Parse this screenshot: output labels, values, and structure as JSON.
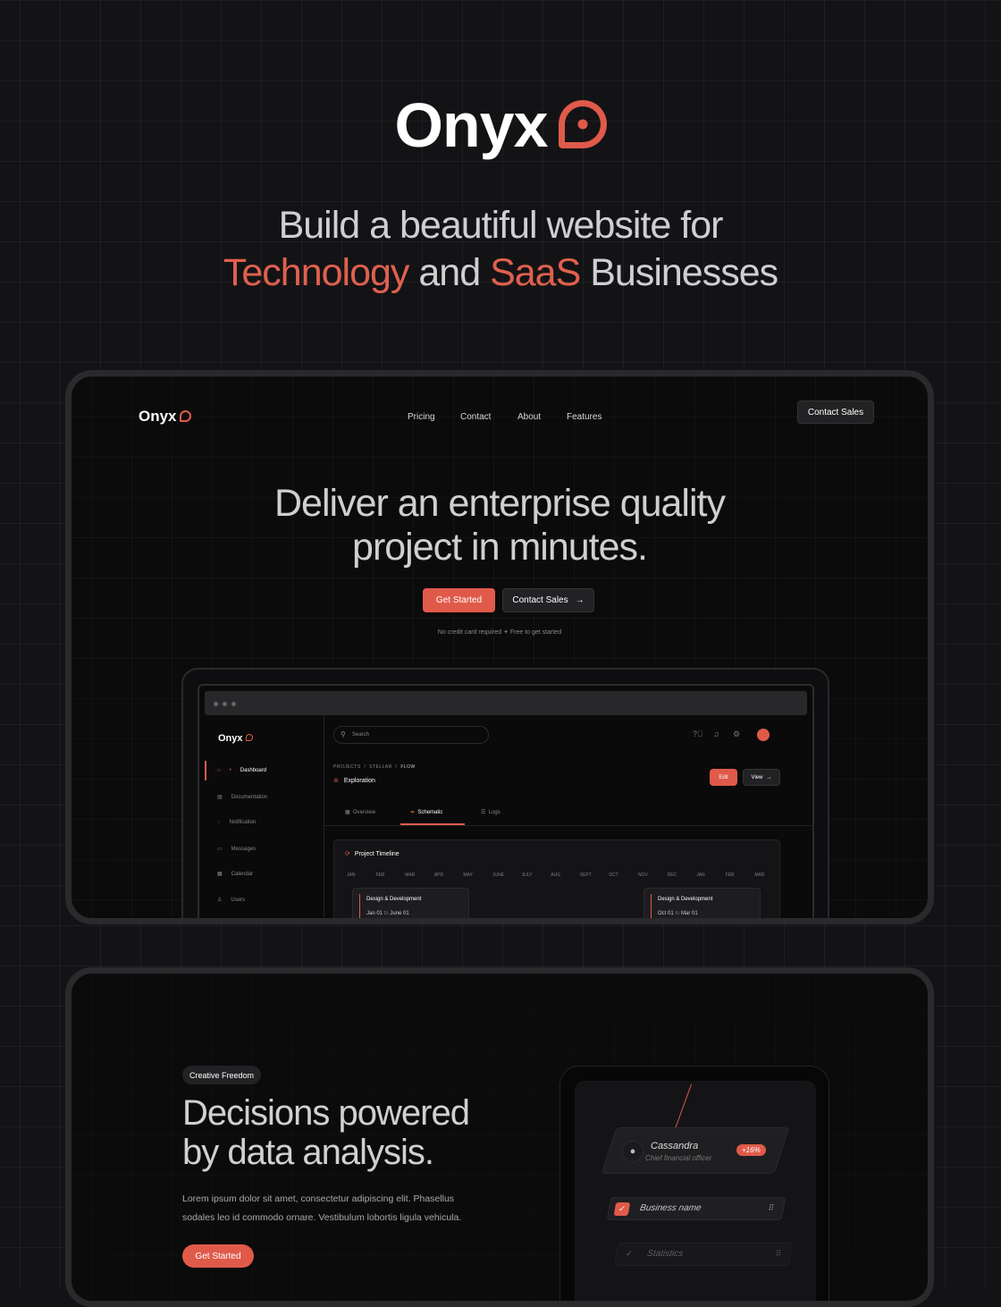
{
  "brand": {
    "name": "Onyx",
    "accent": "#e05a4a"
  },
  "headline": {
    "line1": "Build a beautiful website for",
    "word1": "Technology",
    "and": "and",
    "word2": "SaaS",
    "rest": "Businesses"
  },
  "site": {
    "nav": [
      "Pricing",
      "Contact",
      "About",
      "Features"
    ],
    "contact_sales": "Contact Sales",
    "hero_line1": "Deliver an enterprise quality",
    "hero_line2": "project in minutes.",
    "get_started": "Get Started",
    "contact_sales_btn": "Contact Sales",
    "note1": "No credit card required",
    "note2": "Free to get started"
  },
  "app": {
    "search_placeholder": "Search",
    "sidebar": [
      "Dashboard",
      "Documentation",
      "Notification",
      "Messages",
      "Calendar",
      "Users"
    ],
    "breadcrumb": [
      "PROJECTS",
      "STELLAR",
      "FLOW"
    ],
    "page_title": "Exploration",
    "edit": "Edit",
    "view": "View",
    "tabs": [
      "Overview",
      "Schematic",
      "Logs"
    ],
    "timeline_title": "Project Timeline",
    "months": [
      "JAN",
      "FEB",
      "MAR",
      "APR",
      "MAY",
      "JUNE",
      "JULY",
      "AUG",
      "SEPT",
      "OCT",
      "NOV",
      "DEC",
      "JAN",
      "FEB",
      "MAR"
    ],
    "cards": [
      {
        "title": "Design & Development",
        "from": "Jan 01",
        "to_word": "to",
        "to": "June 01"
      },
      {
        "title": "Design & Development",
        "from": "Oct 01",
        "to_word": "to",
        "to": "Mar 01"
      }
    ]
  },
  "feature": {
    "badge": "Creative Freedom",
    "title1": "Decisions powered",
    "title2": "by data analysis.",
    "para1": "Lorem ipsum dolor sit amet, consectetur adipiscing elit. Phasellus",
    "para2": "sodales leo id commodo ornare. Vestibulum lobortis ligula vehicula.",
    "cta": "Get Started",
    "person": {
      "name": "Cassandra",
      "role": "Chief financial officer",
      "change": "+16%"
    },
    "row1": "Business name",
    "row2": "Statistics"
  }
}
